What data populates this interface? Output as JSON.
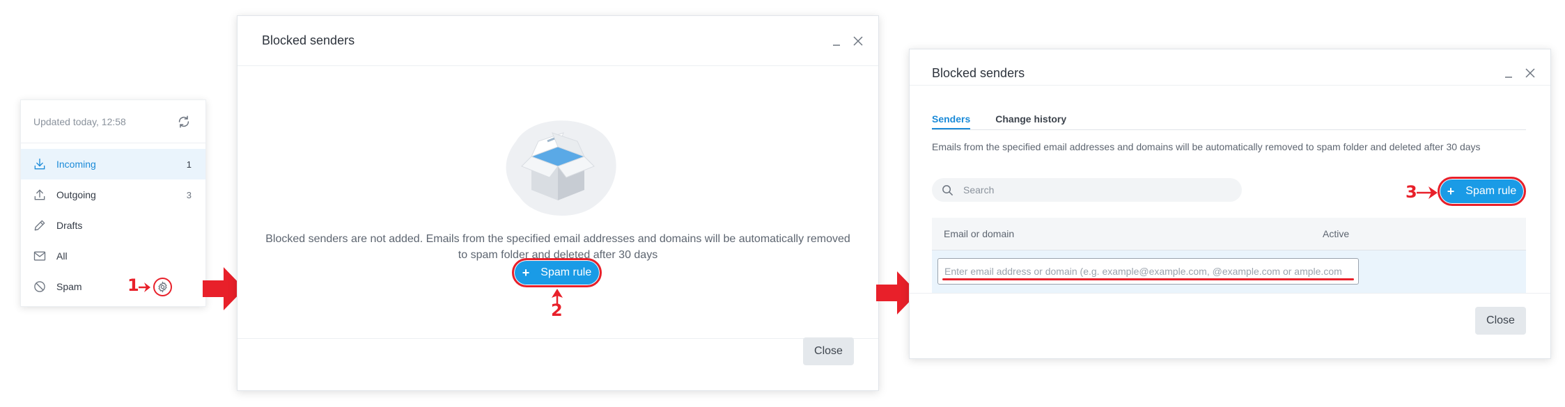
{
  "folders": {
    "updated": "Updated today, 12:58",
    "items": [
      {
        "label": "Incoming",
        "count": "1",
        "icon": "download-icon"
      },
      {
        "label": "Outgoing",
        "count": "3",
        "icon": "upload-icon"
      },
      {
        "label": "Drafts",
        "count": "",
        "icon": "pencil-icon"
      },
      {
        "label": "All",
        "count": "",
        "icon": "envelope-icon"
      },
      {
        "label": "Spam",
        "count": "",
        "icon": "blocked-icon"
      }
    ]
  },
  "steps": {
    "one": "1",
    "two": "2",
    "three": "3"
  },
  "dialog1": {
    "title": "Blocked senders",
    "empty_text": "Blocked senders are not added. Emails from the specified email addresses and domains will be automatically removed to spam folder and deleted after 30 days",
    "spam_rule_label": "Spam rule",
    "plus": "+",
    "close_label": "Close"
  },
  "dialog2": {
    "title": "Blocked senders",
    "tabs": [
      "Senders",
      "Change history"
    ],
    "hint": "Emails from the specified email addresses and domains will be automatically removed to spam folder and deleted after 30 days",
    "search_placeholder": "Search",
    "spam_rule_label": "Spam rule",
    "plus": "+",
    "columns": [
      "Email or domain",
      "Active"
    ],
    "input_placeholder": "Enter email address or domain (e.g. example@example.com, @example.com or ample.com",
    "close_label": "Close"
  },
  "colors": {
    "accent": "#1a9be6",
    "highlight": "#e8202a",
    "active_bg": "#eaf4fc"
  }
}
